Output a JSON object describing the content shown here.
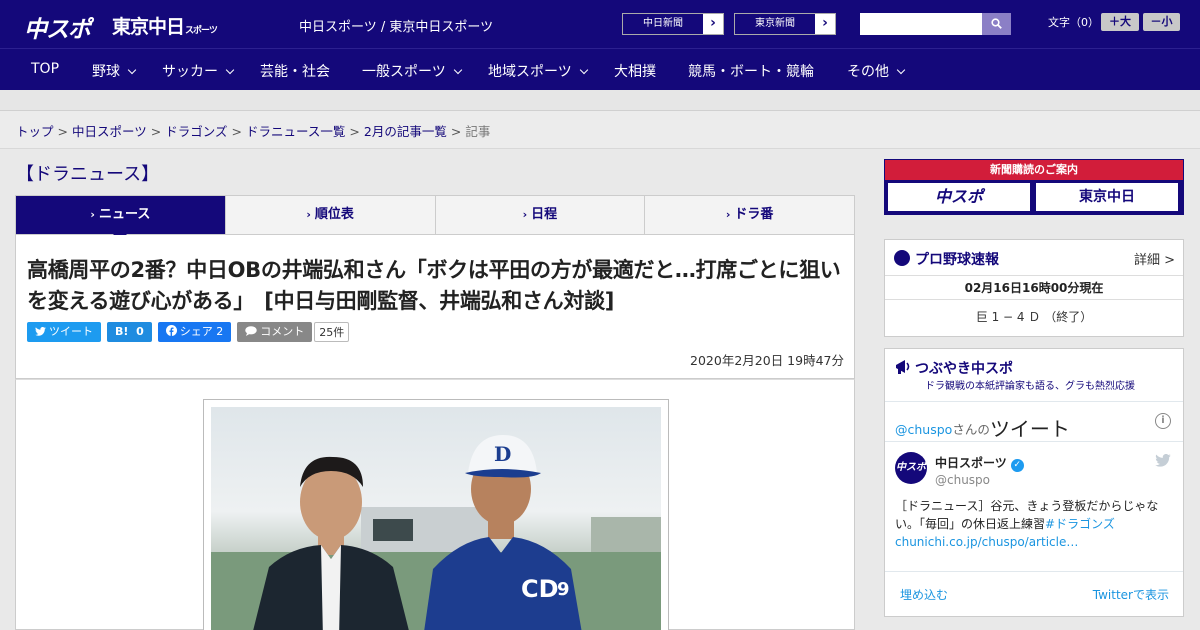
{
  "header": {
    "logo_chuspo": "中スポ",
    "logo_tokyo": "東京中日",
    "logo_tokyo_small": "スポーツ",
    "site_name": "中日スポーツ / 東京中日スポーツ",
    "ext_links": [
      {
        "label": "中日新聞",
        "arrow": "›"
      },
      {
        "label": "東京新聞",
        "arrow": "›"
      }
    ],
    "search_placeholder": "",
    "font_label": "文字（0）",
    "font_bigger": "＋大",
    "font_smaller": "－小"
  },
  "nav": {
    "items": [
      {
        "label": "TOP",
        "has_menu": false
      },
      {
        "label": "野球",
        "has_menu": true
      },
      {
        "label": "サッカー",
        "has_menu": true
      },
      {
        "label": "芸能・社会",
        "has_menu": false
      },
      {
        "label": "一般スポーツ",
        "has_menu": true
      },
      {
        "label": "地域スポーツ",
        "has_menu": true
      },
      {
        "label": "大相撲",
        "has_menu": false
      },
      {
        "label": "競馬・ボート・競輪",
        "has_menu": false
      },
      {
        "label": "その他",
        "has_menu": true
      }
    ]
  },
  "breadcrumb": {
    "items": [
      "トップ",
      "中日スポーツ",
      "ドラゴンズ",
      "ドラニュース一覧",
      "2月の記事一覧"
    ],
    "current": "記事",
    "separator": ">"
  },
  "main": {
    "section_title": "【ドラニュース】",
    "tabs": [
      {
        "label": "ニュース",
        "active": true
      },
      {
        "label": "順位表",
        "active": false
      },
      {
        "label": "日程",
        "active": false
      },
      {
        "label": "ドラ番",
        "active": false
      }
    ],
    "tab_marker": "›",
    "headline": "高橋周平の2番？中日OBの井端弘和さん「ボクは平田の方が最適だと…打席ごとに狙いを変える遊び心がある」　[中日与田剛監督、井端弘和さん対談]",
    "share": {
      "tweet": "ツイート",
      "hatena_label": "B!",
      "hatena_count": "0",
      "facebook": "シェア",
      "facebook_count": "2",
      "comment": "コメント",
      "comment_count": "25件"
    },
    "date": "2020年2月20日 19時47分"
  },
  "sidebar": {
    "ad": {
      "title": "新聞購読のご案内",
      "logo1": "中スポ",
      "logo2": "東京中日"
    },
    "scores": {
      "title": "プロ野球速報",
      "more": "詳細 >",
      "time": "02月16日16時00分現在",
      "line": "巨 1 − 4 Ｄ （終了）"
    },
    "tweets": {
      "title": "つぶやき中スポ",
      "subtitle": "ドラ観戦の本紙評論家も語る、グラも熱烈応援",
      "handle": "@chuspo",
      "handle_suffix": "さんの",
      "handle_word": "ツイート",
      "info": "i",
      "user_name": "中日スポーツ",
      "user_id": "@chuspo",
      "avatar_text": "中スポ",
      "text": "［ドラニュース］谷元、きょう登板だからじゃない。「毎回」の休日返上練習",
      "hashtag": "#ドラゴンズ",
      "link": "chunichi.co.jp/chuspo/article…",
      "embed": "埋め込む",
      "view": "Twitterで表示"
    }
  },
  "colors": {
    "brand": "#14087a",
    "accent_red": "#d21d3a",
    "twitter": "#1d9bf0"
  }
}
